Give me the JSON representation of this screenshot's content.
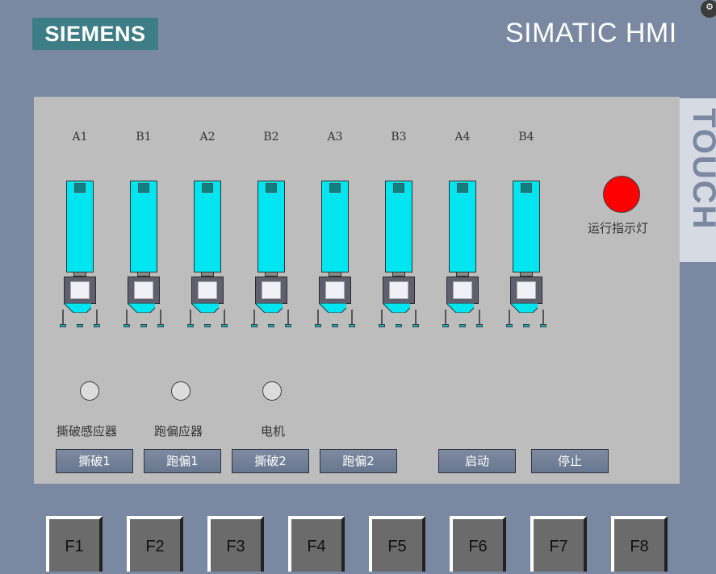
{
  "header": {
    "brand_logo": "SIEMENS",
    "product_title": "SIMATIC HMI",
    "corner_icon": "gear-icon",
    "side_strip_text": "TOUCH"
  },
  "screen": {
    "hoppers": [
      {
        "label": "A1"
      },
      {
        "label": "B1"
      },
      {
        "label": "A2"
      },
      {
        "label": "B2"
      },
      {
        "label": "A3"
      },
      {
        "label": "B3"
      },
      {
        "label": "A4"
      },
      {
        "label": "B4"
      }
    ],
    "run_indicator": {
      "label": "运行指示灯",
      "color": "#ff0000",
      "state": "on"
    },
    "sensors": [
      {
        "label": "撕破感应器"
      },
      {
        "label": "跑偏应器"
      },
      {
        "label": "电机"
      }
    ],
    "buttons": {
      "tear1": "撕破1",
      "drift1": "跑偏1",
      "tear2": "撕破2",
      "drift2": "跑偏2",
      "start": "启动",
      "stop": "停止"
    }
  },
  "function_keys": [
    "F1",
    "F2",
    "F3",
    "F4",
    "F5",
    "F6",
    "F7",
    "F8"
  ],
  "colors": {
    "panel_frame": "#7a89a1",
    "screen_background": "#bdbdbd",
    "silo_fill": "#00e5f0",
    "logo_background": "#3d7d86",
    "indicator_red": "#ff0000"
  }
}
